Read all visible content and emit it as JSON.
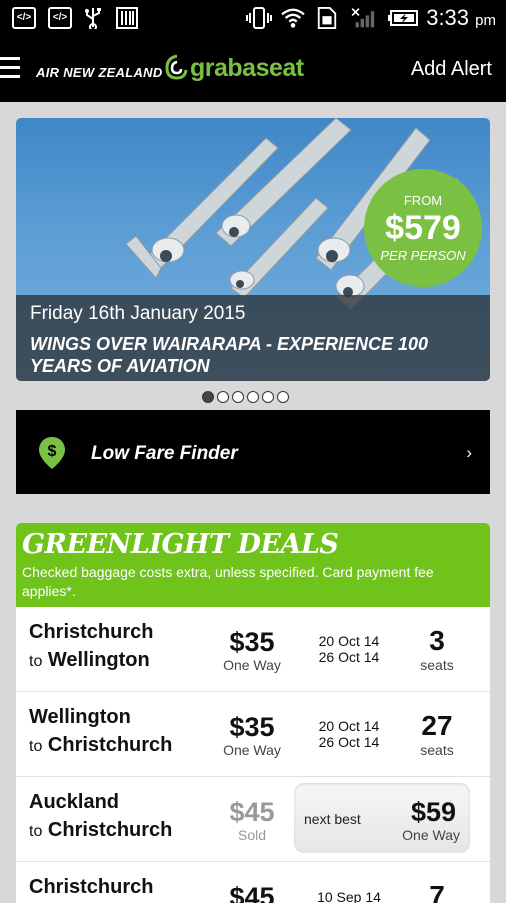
{
  "status_bar": {
    "left_icons": [
      "code-icon",
      "code-icon",
      "usb-icon",
      "barcode-icon"
    ],
    "right_icons": [
      "vibrate-icon",
      "wifi-icon",
      "sim-icon",
      "signal-icon",
      "battery-charging-icon"
    ],
    "time": "3:33",
    "ampm": "pm"
  },
  "app_bar": {
    "brand_anz": "AIR NEW ZEALAND",
    "brand_gas": "grabaseat",
    "add_alert": "Add Alert"
  },
  "hero": {
    "price_from": "FROM",
    "price": "$579",
    "price_per": "PER PERSON",
    "date": "Friday 16th January 2015",
    "title": "WINGS OVER WAIRARAPA - EXPERIENCE 100 YEARS OF AVIATION",
    "page_count": 6,
    "active_page": 1
  },
  "low_fare_finder": {
    "label": "Low Fare Finder"
  },
  "deals": {
    "title": "GREENLIGHT DEALS",
    "note": "Checked baggage costs extra, unless specified. Card payment fee applies*.",
    "to_word": "to",
    "rows": [
      {
        "from": "Christchurch",
        "to": "Wellington",
        "price": "$35",
        "price_sub": "One Way",
        "date1": "20 Oct 14",
        "date2": "26 Oct 14",
        "seats": "3",
        "seats_sub": "seats"
      },
      {
        "from": "Wellington",
        "to": "Christchurch",
        "price": "$35",
        "price_sub": "One Way",
        "date1": "20 Oct 14",
        "date2": "26 Oct 14",
        "seats": "27",
        "seats_sub": "seats"
      },
      {
        "from": "Auckland",
        "to": "Christchurch",
        "price": "$45",
        "price_sub": "Sold",
        "next_label": "next best",
        "next_price": "$59",
        "next_sub": "One Way"
      },
      {
        "from": "Christchurch",
        "price": "$45",
        "date1": "10 Sep 14",
        "seats": "7"
      }
    ]
  },
  "colors": {
    "brand_green": "#7ac143",
    "deals_green": "#6fc31b",
    "bar_black": "#000000"
  }
}
